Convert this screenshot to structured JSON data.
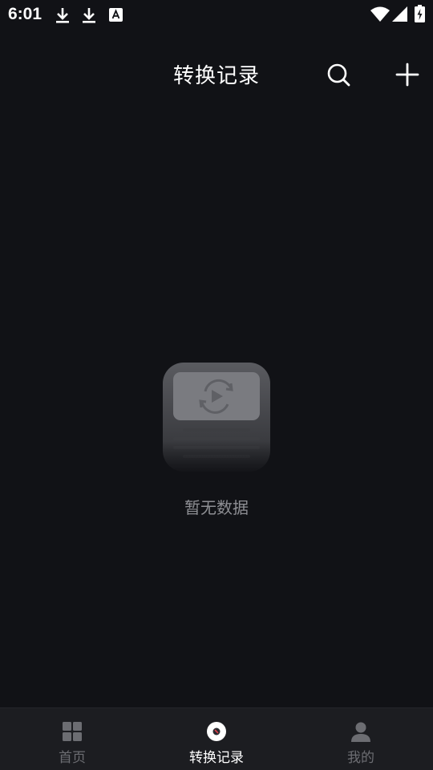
{
  "status_bar": {
    "time": "6:01",
    "icons": [
      "download-icon",
      "download-icon",
      "text-a-icon",
      "wifi-icon",
      "signal-icon",
      "battery-icon"
    ]
  },
  "header": {
    "title": "转换记录",
    "search_icon": "search-icon",
    "add_icon": "plus-icon"
  },
  "empty_state": {
    "illustration": "video-convert-illustration",
    "message": "暂无数据"
  },
  "bottom_nav": {
    "tabs": [
      {
        "label": "首页",
        "icon": "grid-icon",
        "active": false
      },
      {
        "label": "转换记录",
        "icon": "record-icon",
        "active": true
      },
      {
        "label": "我的",
        "icon": "user-icon",
        "active": false
      }
    ]
  },
  "colors": {
    "background": "#111216",
    "nav_background": "#1c1d21",
    "text_primary": "#ffffff",
    "text_muted": "#8e8f94",
    "nav_inactive": "#6c6d72"
  }
}
